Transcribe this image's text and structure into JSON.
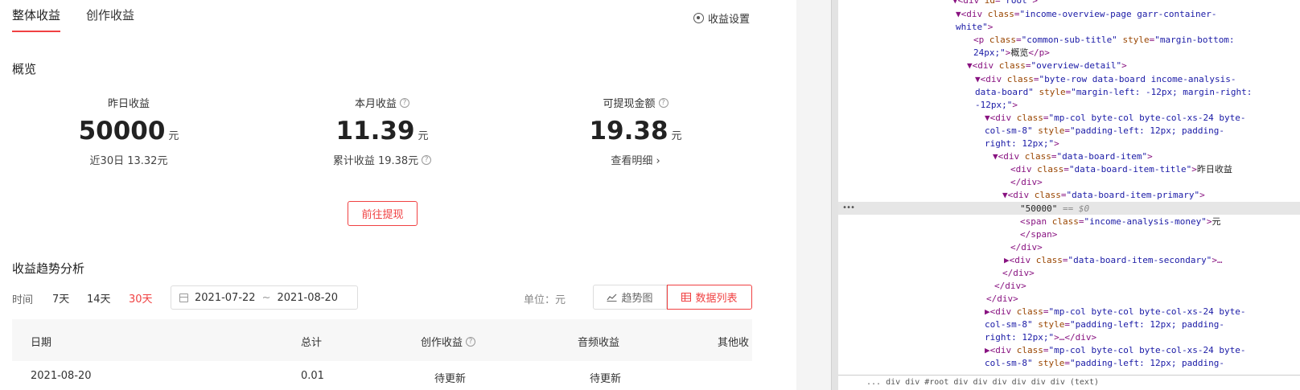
{
  "tabs": [
    {
      "label": "整体收益",
      "active": true
    },
    {
      "label": "创作收益",
      "active": false
    }
  ],
  "header": {
    "settings_label": "收益设置"
  },
  "overview": {
    "title": "概览",
    "boards": [
      {
        "title": "昨日收益",
        "value": "50000",
        "unit": "元",
        "secondary": "近30日 13.32元"
      },
      {
        "title": "本月收益",
        "value": "11.39",
        "unit": "元",
        "secondary": "累计收益 19.38元"
      },
      {
        "title": "可提现金额",
        "value": "19.38",
        "unit": "元",
        "secondary": "查看明细 ›"
      }
    ],
    "withdraw_label": "前往提现"
  },
  "trend": {
    "title": "收益趋势分析",
    "time_label": "时间",
    "ranges": [
      "7天",
      "14天",
      "30天"
    ],
    "active_range": "30天",
    "date_start": "2021-07-22",
    "date_sep": "~",
    "date_end": "2021-08-20",
    "unit_label": "单位：元",
    "view_trend": "趋势图",
    "view_list": "数据列表"
  },
  "table": {
    "columns": [
      "日期",
      "总计",
      "创作收益",
      "音频收益",
      "其他收"
    ],
    "first_row": [
      "2021-08-20",
      "0.01",
      "待更新",
      "待更新"
    ]
  },
  "devtools": {
    "lines": [
      [
        {
          "t": "tag",
          "v": "▼<div "
        },
        {
          "t": "attr",
          "v": "id"
        },
        {
          "t": "tag",
          "v": "="
        },
        {
          "t": "val",
          "v": "\"root\""
        },
        {
          "t": "tag",
          "v": ">"
        }
      ],
      [
        {
          "t": "tag",
          "v": "▼<div "
        },
        {
          "t": "attr",
          "v": "class"
        },
        {
          "t": "tag",
          "v": "="
        },
        {
          "t": "val",
          "v": "\"income-overview-page garr-container-"
        }
      ],
      [
        {
          "t": "val",
          "v": "white\""
        },
        {
          "t": "tag",
          "v": ">"
        }
      ],
      [
        {
          "t": "tag",
          "v": "<p "
        },
        {
          "t": "attr",
          "v": "class"
        },
        {
          "t": "tag",
          "v": "="
        },
        {
          "t": "val",
          "v": "\"common-sub-title\""
        },
        {
          "t": "attr",
          "v": " style"
        },
        {
          "t": "tag",
          "v": "="
        },
        {
          "t": "val",
          "v": "\"margin-bottom:"
        }
      ],
      [
        {
          "t": "val",
          "v": "24px;\""
        },
        {
          "t": "tag",
          "v": ">"
        },
        {
          "t": "txt",
          "v": "概览"
        },
        {
          "t": "tag",
          "v": "</p>"
        }
      ],
      [
        {
          "t": "tag",
          "v": "▼<div "
        },
        {
          "t": "attr",
          "v": "class"
        },
        {
          "t": "tag",
          "v": "="
        },
        {
          "t": "val",
          "v": "\"overview-detail\""
        },
        {
          "t": "tag",
          "v": ">"
        }
      ],
      [
        {
          "t": "tag",
          "v": "▼<div "
        },
        {
          "t": "attr",
          "v": "class"
        },
        {
          "t": "tag",
          "v": "="
        },
        {
          "t": "val",
          "v": "\"byte-row data-board income-analysis-"
        }
      ],
      [
        {
          "t": "val",
          "v": "data-board\""
        },
        {
          "t": "attr",
          "v": " style"
        },
        {
          "t": "tag",
          "v": "="
        },
        {
          "t": "val",
          "v": "\"margin-left: -12px; margin-right:"
        }
      ],
      [
        {
          "t": "val",
          "v": "-12px;\""
        },
        {
          "t": "tag",
          "v": ">"
        }
      ],
      [
        {
          "t": "tag",
          "v": "▼<div "
        },
        {
          "t": "attr",
          "v": "class"
        },
        {
          "t": "tag",
          "v": "="
        },
        {
          "t": "val",
          "v": "\"mp-col byte-col byte-col-xs-24 byte-"
        }
      ],
      [
        {
          "t": "val",
          "v": "col-sm-8\""
        },
        {
          "t": "attr",
          "v": " style"
        },
        {
          "t": "tag",
          "v": "="
        },
        {
          "t": "val",
          "v": "\"padding-left: 12px; padding-"
        }
      ],
      [
        {
          "t": "val",
          "v": "right: 12px;\""
        },
        {
          "t": "tag",
          "v": ">"
        }
      ],
      [
        {
          "t": "tag",
          "v": "▼<div "
        },
        {
          "t": "attr",
          "v": "class"
        },
        {
          "t": "tag",
          "v": "="
        },
        {
          "t": "val",
          "v": "\"data-board-item\""
        },
        {
          "t": "tag",
          "v": ">"
        }
      ],
      [
        {
          "t": "tag",
          "v": "<div "
        },
        {
          "t": "attr",
          "v": "class"
        },
        {
          "t": "tag",
          "v": "="
        },
        {
          "t": "val",
          "v": "\"data-board-item-title\""
        },
        {
          "t": "tag",
          "v": ">"
        },
        {
          "t": "txt",
          "v": "昨日收益"
        }
      ],
      [
        {
          "t": "tag",
          "v": "</div>"
        }
      ],
      [
        {
          "t": "tag",
          "v": "▼<div "
        },
        {
          "t": "attr",
          "v": "class"
        },
        {
          "t": "tag",
          "v": "="
        },
        {
          "t": "val",
          "v": "\"data-board-item-primary\""
        },
        {
          "t": "tag",
          "v": ">"
        }
      ],
      [
        {
          "t": "txt",
          "v": "\"50000\""
        },
        {
          "t": "dollar",
          "v": " == $0"
        }
      ],
      [
        {
          "t": "tag",
          "v": "<span "
        },
        {
          "t": "attr",
          "v": "class"
        },
        {
          "t": "tag",
          "v": "="
        },
        {
          "t": "val",
          "v": "\"income-analysis-money\""
        },
        {
          "t": "tag",
          "v": ">"
        },
        {
          "t": "txt",
          "v": "元"
        }
      ],
      [
        {
          "t": "tag",
          "v": "</span>"
        }
      ],
      [
        {
          "t": "tag",
          "v": "</div>"
        }
      ],
      [
        {
          "t": "tag",
          "v": "▶<div "
        },
        {
          "t": "attr",
          "v": "class"
        },
        {
          "t": "tag",
          "v": "="
        },
        {
          "t": "val",
          "v": "\"data-board-item-secondary\""
        },
        {
          "t": "tag",
          "v": ">…"
        }
      ],
      [
        {
          "t": "tag",
          "v": "</div>"
        }
      ],
      [
        {
          "t": "tag",
          "v": "</div>"
        }
      ],
      [
        {
          "t": "tag",
          "v": "</div>"
        }
      ],
      [
        {
          "t": "tag",
          "v": "▶<div "
        },
        {
          "t": "attr",
          "v": "class"
        },
        {
          "t": "tag",
          "v": "="
        },
        {
          "t": "val",
          "v": "\"mp-col byte-col byte-col-xs-24 byte-"
        }
      ],
      [
        {
          "t": "val",
          "v": "col-sm-8\""
        },
        {
          "t": "attr",
          "v": " style"
        },
        {
          "t": "tag",
          "v": "="
        },
        {
          "t": "val",
          "v": "\"padding-left: 12px; padding-"
        }
      ],
      [
        {
          "t": "val",
          "v": "right: 12px;\""
        },
        {
          "t": "tag",
          "v": ">…</div>"
        }
      ],
      [
        {
          "t": "tag",
          "v": "▶<div "
        },
        {
          "t": "attr",
          "v": "class"
        },
        {
          "t": "tag",
          "v": "="
        },
        {
          "t": "val",
          "v": "\"mp-col byte-col byte-col-xs-24 byte-"
        }
      ],
      [
        {
          "t": "val",
          "v": "col-sm-8\""
        },
        {
          "t": "attr",
          "v": " style"
        },
        {
          "t": "tag",
          "v": "="
        },
        {
          "t": "val",
          "v": "\"padding-left: 12px; padding-"
        }
      ]
    ],
    "breadcrumbs": "... div  div  #root  div  div  div  div  div  div  (text)"
  }
}
